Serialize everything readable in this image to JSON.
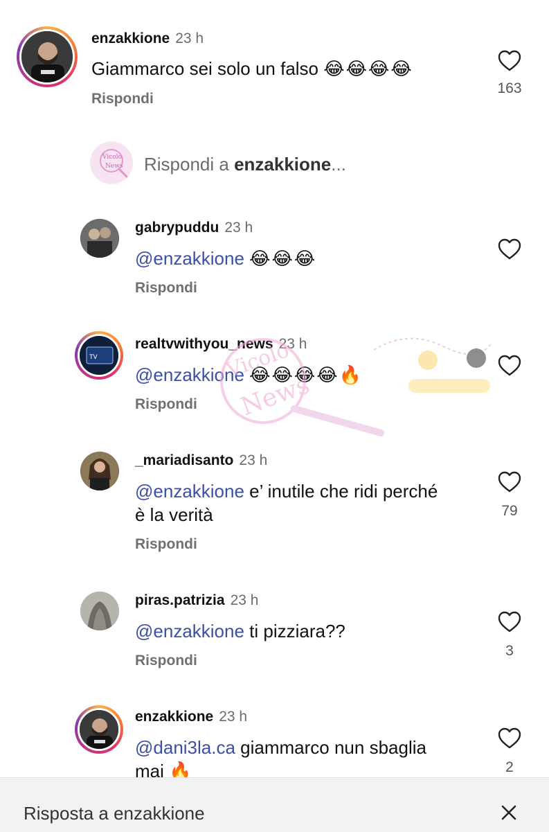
{
  "comments": [
    {
      "username": "enzakkione",
      "time": "23 h",
      "text": "Giammarco sei solo un falso",
      "emoji": "😂😂😂😂",
      "reply": "Rispondi",
      "likes": "163"
    },
    {
      "username": "gabrypuddu",
      "time": "23 h",
      "mention": "@enzakkione",
      "text": "",
      "emoji": "😂😂😂",
      "reply": "Rispondi",
      "likes": ""
    },
    {
      "username": "realtvwithyou_news",
      "time": "23 h",
      "mention": "@enzakkione",
      "text": "",
      "emoji": "😂😂😂😂🔥",
      "reply": "Rispondi",
      "likes": ""
    },
    {
      "username": "_mariadisanto",
      "time": "23 h",
      "mention": "@enzakkione",
      "text": " e’ inutile che ridi perché",
      "text2": "è la verità",
      "reply": "Rispondi",
      "likes": "79"
    },
    {
      "username": "piras.patrizia",
      "time": "23 h",
      "mention": "@enzakkione",
      "text": " ti pizziara??",
      "reply": "Rispondi",
      "likes": "3"
    },
    {
      "username": "enzakkione",
      "time": "23 h",
      "mention": "@dani3la.ca",
      "text": " giammarco nun sbaglia",
      "text2": "mai",
      "emoji": "🔥",
      "likes": "2"
    }
  ],
  "composer": {
    "prefix": "Rispondi a ",
    "username": "enzakkione",
    "suffix": "..."
  },
  "bottom_bar": {
    "label": "Risposta a enzakkione"
  },
  "colors": {
    "mention": "#3b4fa8",
    "background": "#ffffff",
    "bottom_bar": "#f2f2f4"
  }
}
